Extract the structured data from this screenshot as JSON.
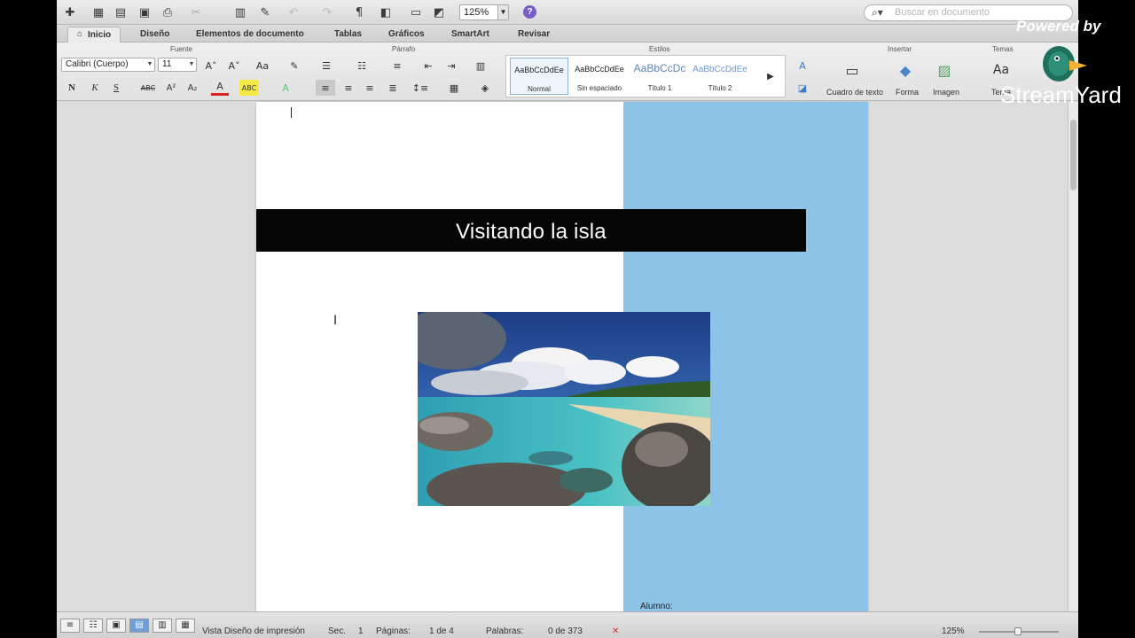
{
  "toolbar": {
    "zoom": "125%",
    "search_placeholder": "Buscar en documento"
  },
  "tabs": [
    "Inicio",
    "Diseño",
    "Elementos de documento",
    "Tablas",
    "Gráficos",
    "SmartArt",
    "Revisar"
  ],
  "ribbon": {
    "groups": {
      "fuente": "Fuente",
      "parrafo": "Párrafo",
      "estilos": "Estilos",
      "insertar": "Insertar",
      "temas": "Temas"
    },
    "font_name": "Calibri (Cuerpo)",
    "font_size": "11",
    "styles": [
      {
        "sample": "AaBbCcDdEe",
        "name": "Normal"
      },
      {
        "sample": "AaBbCcDdEe",
        "name": "Sin espaciado"
      },
      {
        "sample": "AaBbCcDc",
        "name": "Título 1"
      },
      {
        "sample": "AaBbCcDdEe",
        "name": "Título 2"
      }
    ],
    "insert": {
      "textbox": "Cuadro de texto",
      "shape": "Forma",
      "image": "Imagen",
      "themes": "Temas"
    }
  },
  "document": {
    "banner_title": "Visitando la isla",
    "sidebar_label": "Alumno:"
  },
  "status": {
    "view": "Vista Diseño de impresión",
    "sec_label": "Sec.",
    "sec_value": "1",
    "pages_label": "Páginas:",
    "pages_value": "1 de 4",
    "words_label": "Palabras:",
    "words_value": "0 de 373",
    "zoom": "125%"
  },
  "watermark": {
    "powered": "Powered by",
    "brand": "StreamYard"
  },
  "colors": {
    "sidebar": "#8ec3e8",
    "banner": "#050505",
    "active_view": "#6f9fd8"
  }
}
